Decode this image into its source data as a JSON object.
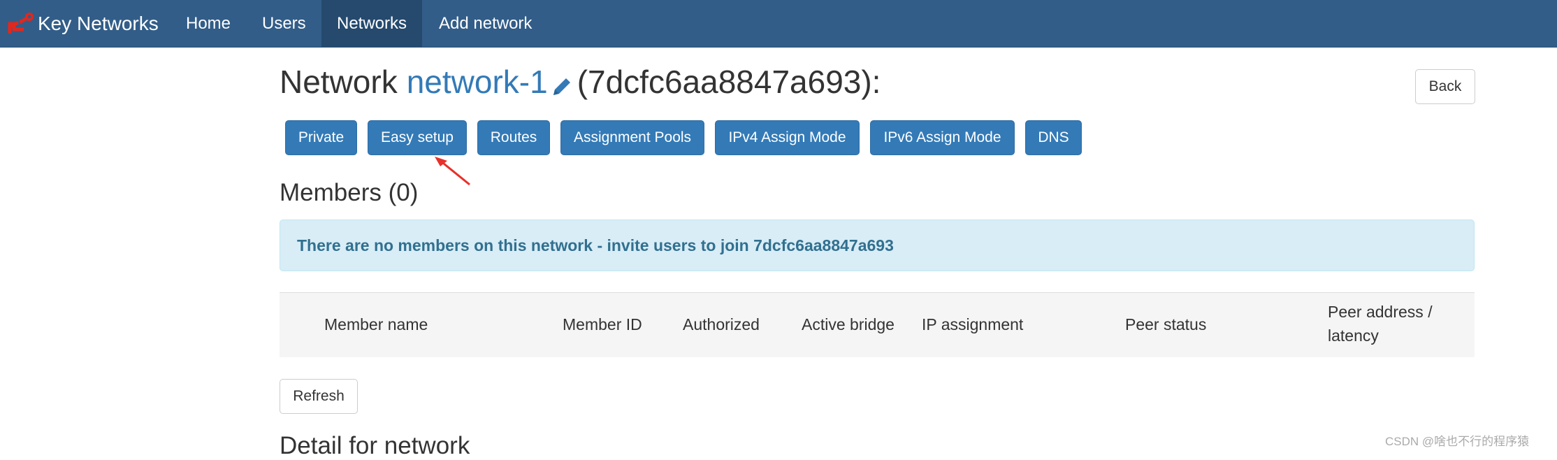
{
  "navbar": {
    "brand_label": "Key Networks",
    "items": [
      {
        "label": "Home"
      },
      {
        "label": "Users"
      },
      {
        "label": "Networks",
        "active": true
      },
      {
        "label": "Add network"
      }
    ]
  },
  "header": {
    "prefix": "Network",
    "network_name": "network-1",
    "network_id_suffix": "(7dcfc6aa8847a693):",
    "back_label": "Back"
  },
  "actions": [
    {
      "label": "Private"
    },
    {
      "label": "Easy setup"
    },
    {
      "label": "Routes"
    },
    {
      "label": "Assignment Pools"
    },
    {
      "label": "IPv4 Assign Mode"
    },
    {
      "label": "IPv6 Assign Mode"
    },
    {
      "label": "DNS"
    }
  ],
  "members": {
    "heading": "Members (0)",
    "empty_message": "There are no members on this network - invite users to join 7dcfc6aa8847a693",
    "columns": [
      "Member name",
      "Member ID",
      "Authorized",
      "Active bridge",
      "IP assignment",
      "Peer status",
      "Peer address /",
      "latency"
    ],
    "refresh_label": "Refresh"
  },
  "detail": {
    "heading": "Detail for network"
  },
  "watermark": "CSDN @啥也不行的程序猿",
  "colors": {
    "navbar": "#325d88",
    "navbar_active": "#254a6e",
    "primary_button": "#337ab7",
    "info_background": "#d9edf7",
    "info_text": "#31708f",
    "annotation_arrow": "#e8302a"
  },
  "icons": {
    "brand": "key-logo-icon",
    "edit": "pencil-icon",
    "annotation": "red-arrow-icon"
  }
}
